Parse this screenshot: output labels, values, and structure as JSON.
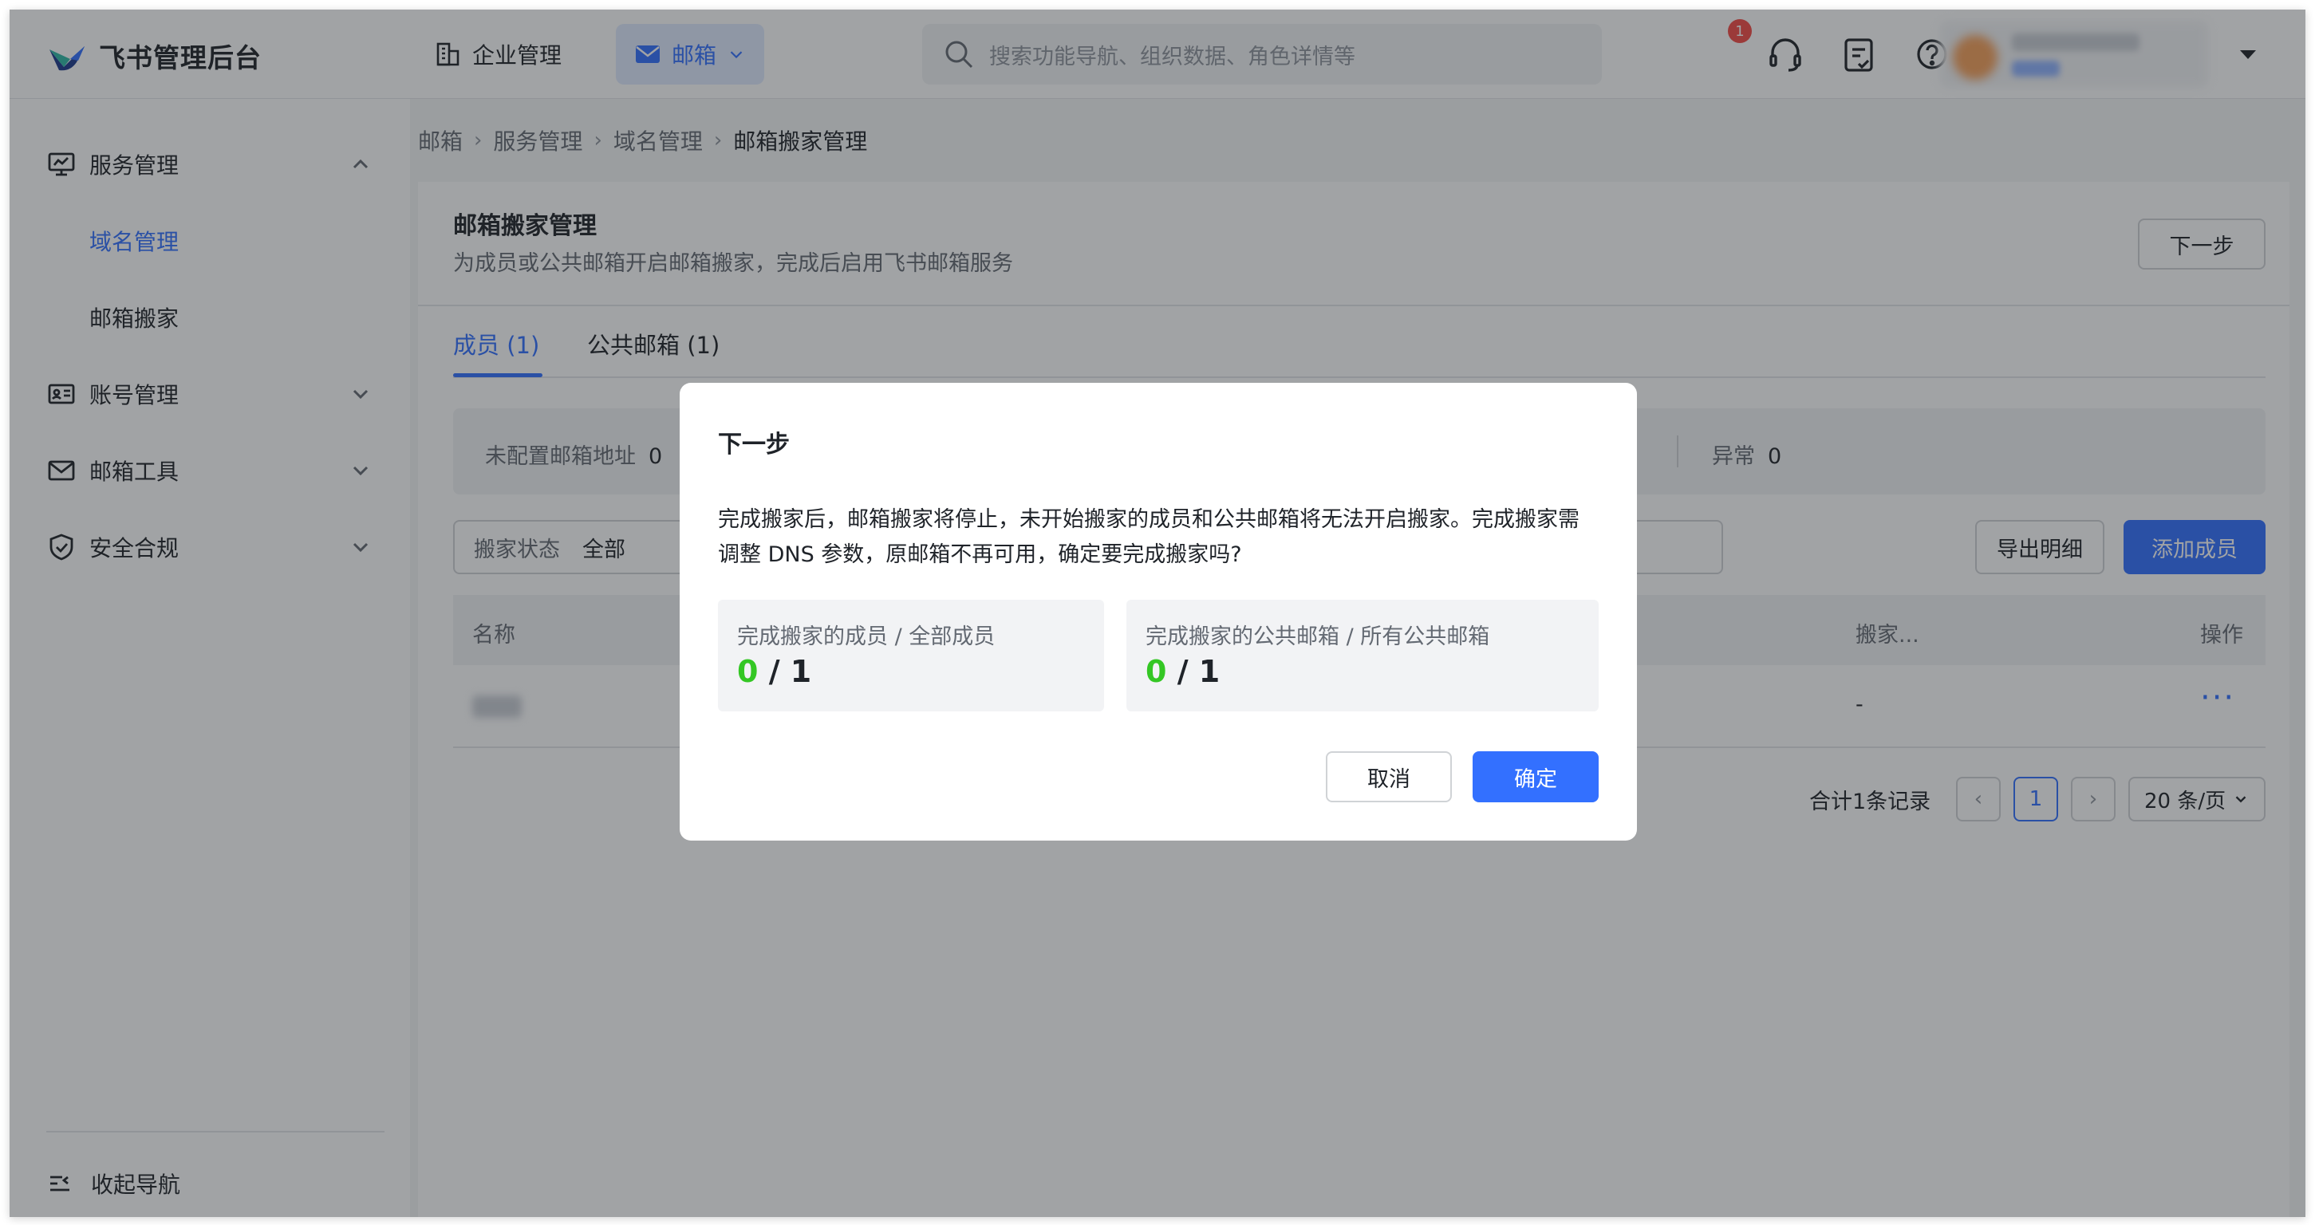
{
  "app": {
    "title": "飞书管理后台"
  },
  "header": {
    "nav_enterprise": "企业管理",
    "nav_mail": "邮箱",
    "search_placeholder": "搜索功能导航、组织数据、角色详情等",
    "notification_count": "1"
  },
  "sidebar": {
    "service_mgmt": "服务管理",
    "domain_mgmt": "域名管理",
    "mail_migration": "邮箱搬家",
    "account_mgmt": "账号管理",
    "mail_tools": "邮箱工具",
    "security": "安全合规",
    "collapse": "收起导航"
  },
  "breadcrumb": [
    "邮箱",
    "服务管理",
    "域名管理",
    "邮箱搬家管理"
  ],
  "page": {
    "title": "邮箱搬家管理",
    "description": "为成员或公共邮箱开启邮箱搬家，完成后启用飞书邮箱服务",
    "next_button": "下一步",
    "tabs": [
      "成员 (1)",
      "公共邮箱 (1)"
    ],
    "stats": {
      "unconfigured_label": "未配置邮箱地址",
      "unconfigured_value": "0",
      "abnormal_label": "异常",
      "abnormal_value": "0"
    },
    "filter": {
      "label": "搬家状态",
      "value": "全部"
    },
    "export_button": "导出明细",
    "add_button": "添加成员",
    "table": {
      "headers": [
        "名称",
        "搬家...",
        "操作"
      ],
      "row": {
        "status": "-",
        "action": "···"
      }
    },
    "pagination": {
      "total": "合计1条记录",
      "current": "1",
      "page_size": "20 条/页"
    }
  },
  "modal": {
    "title": "下一步",
    "body": "完成搬家后，邮箱搬家将停止，未开始搬家的成员和公共邮箱将无法开启搬家。完成搬家需调整 DNS 参数，原邮箱不再可用，确定要完成搬家吗?",
    "box1_label": "完成搬家的成员 / 全部成员",
    "box1_done": "0",
    "box1_total": "/ 1",
    "box2_label": "完成搬家的公共邮箱 / 所有公共邮箱",
    "box2_done": "0",
    "box2_total": "/ 1",
    "cancel": "取消",
    "confirm": "确定"
  },
  "colors": {
    "primary": "#3370ff",
    "success": "#34c724",
    "badge": "#f54a45"
  }
}
